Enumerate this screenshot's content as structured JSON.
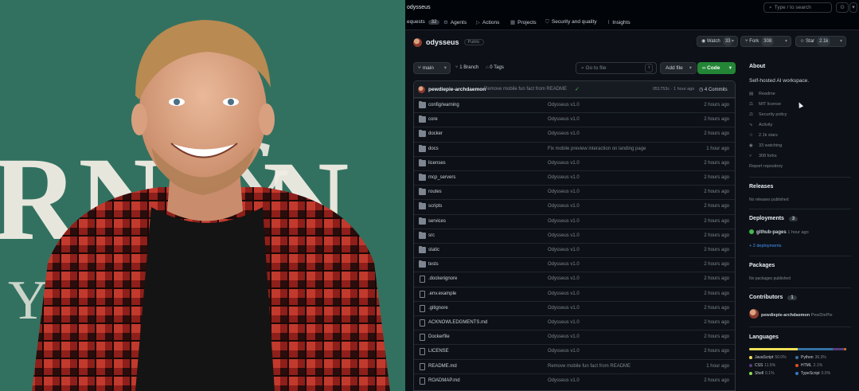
{
  "topbar": {
    "repo_crumb": "odysseus",
    "search_placeholder": "Type / to search",
    "search_icon": "search-icon",
    "copilot_icon": "copilot-icon",
    "caret_icon": "chevron-down-icon"
  },
  "repo_nav": {
    "pull_requests": {
      "label": "equests",
      "count": "32"
    },
    "agents": "Agents",
    "actions": "Actions",
    "projects": "Projects",
    "security": "Security and quality",
    "insights": "Insights"
  },
  "repo": {
    "name": "odysseus",
    "visibility": "Public",
    "watch": {
      "label": "Watch",
      "count": "33"
    },
    "fork": {
      "label": "Fork",
      "count": "308"
    },
    "star": {
      "label": "Star",
      "count": "2.1k"
    }
  },
  "toolbar": {
    "branch": "main",
    "branches": "1 Branch",
    "tags": "0 Tags",
    "goto_placeholder": "Go to file",
    "goto_kbd": "t",
    "add_file": "Add file",
    "code": "Code"
  },
  "last_commit": {
    "author": "pewdiepie-archdaemon",
    "message": "Remove mobile fun fact from README",
    "check": "✓",
    "meta": "051753c · 1 hour ago",
    "count_label": "4 Commits"
  },
  "files": [
    {
      "type": "folder",
      "name": "config/warning",
      "message": "Odysseus v1.0",
      "age": "2 hours ago"
    },
    {
      "type": "folder",
      "name": "core",
      "message": "Odysseus v1.0",
      "age": "2 hours ago"
    },
    {
      "type": "folder",
      "name": "docker",
      "message": "Odysseus v1.0",
      "age": "2 hours ago"
    },
    {
      "type": "folder",
      "name": "docs",
      "message": "Fix mobile preview interaction on landing page",
      "age": "1 hour ago"
    },
    {
      "type": "folder",
      "name": "licenses",
      "message": "Odysseus v1.0",
      "age": "2 hours ago"
    },
    {
      "type": "folder",
      "name": "mcp_servers",
      "message": "Odysseus v1.0",
      "age": "2 hours ago"
    },
    {
      "type": "folder",
      "name": "routes",
      "message": "Odysseus v1.0",
      "age": "2 hours ago"
    },
    {
      "type": "folder",
      "name": "scripts",
      "message": "Odysseus v1.0",
      "age": "2 hours ago"
    },
    {
      "type": "folder",
      "name": "services",
      "message": "Odysseus v1.0",
      "age": "2 hours ago"
    },
    {
      "type": "folder",
      "name": "src",
      "message": "Odysseus v1.0",
      "age": "2 hours ago"
    },
    {
      "type": "folder",
      "name": "static",
      "message": "Odysseus v1.0",
      "age": "2 hours ago"
    },
    {
      "type": "folder",
      "name": "tests",
      "message": "Odysseus v1.0",
      "age": "2 hours ago"
    },
    {
      "type": "file",
      "name": ".dockerignore",
      "message": "Odysseus v1.0",
      "age": "2 hours ago"
    },
    {
      "type": "file",
      "name": ".env.example",
      "message": "Odysseus v1.0",
      "age": "2 hours ago"
    },
    {
      "type": "file",
      "name": ".gitignore",
      "message": "Odysseus v1.0",
      "age": "2 hours ago"
    },
    {
      "type": "file",
      "name": "ACKNOWLEDGMENTS.md",
      "message": "Odysseus v1.0",
      "age": "2 hours ago"
    },
    {
      "type": "file",
      "name": "Dockerfile",
      "message": "Odysseus v1.0",
      "age": "2 hours ago"
    },
    {
      "type": "file",
      "name": "LICENSE",
      "message": "Odysseus v1.0",
      "age": "2 hours ago"
    },
    {
      "type": "file",
      "name": "README.md",
      "message": "Remove mobile fun fact from README",
      "age": "1 hour ago"
    },
    {
      "type": "file",
      "name": "ROADMAP.md",
      "message": "Odysseus v1.0",
      "age": "2 hours ago"
    }
  ],
  "about": {
    "heading": "About",
    "description": "Self-hosted AI workspace.",
    "links": [
      {
        "icon": "book-icon",
        "label": "Readme"
      },
      {
        "icon": "scale-icon",
        "label": "MIT license"
      },
      {
        "icon": "scale-icon",
        "label": "Security policy"
      },
      {
        "icon": "pulse-icon",
        "label": "Activity"
      },
      {
        "icon": "star-icon",
        "label": "2.1k stars"
      },
      {
        "icon": "eye-icon",
        "label": "33 watching"
      },
      {
        "icon": "fork-icon",
        "label": "308 forks"
      }
    ],
    "report": "Report repository"
  },
  "releases": {
    "heading": "Releases",
    "empty": "No releases published"
  },
  "deployments": {
    "heading": "Deployments",
    "count": "3",
    "env": "github-pages",
    "age": "1 hour ago",
    "more": "+ 2 deployments"
  },
  "packages": {
    "heading": "Packages",
    "empty": "No packages published"
  },
  "contributors": {
    "heading": "Contributors",
    "count": "1",
    "name": "pewdiepie-archdaemon",
    "display": "PewDiePie"
  },
  "languages": {
    "heading": "Languages",
    "items": [
      {
        "name": "JavaScript",
        "pct": "50.0%",
        "color": "#f1e05a"
      },
      {
        "name": "Python",
        "pct": "36.3%",
        "color": "#3572A5"
      },
      {
        "name": "CSS",
        "pct": "11.5%",
        "color": "#563d7c"
      },
      {
        "name": "HTML",
        "pct": "2.1%",
        "color": "#e34c26"
      },
      {
        "name": "Shell",
        "pct": "0.1%",
        "color": "#89e051"
      },
      {
        "name": "TypeScript",
        "pct": "0.0%",
        "color": "#3178c6"
      }
    ]
  },
  "colors": {
    "bg": "#0d1117",
    "border": "#30363d",
    "accent_green": "#238636",
    "link_blue": "#4493f8",
    "photo_bg": "#2f6d5e"
  }
}
